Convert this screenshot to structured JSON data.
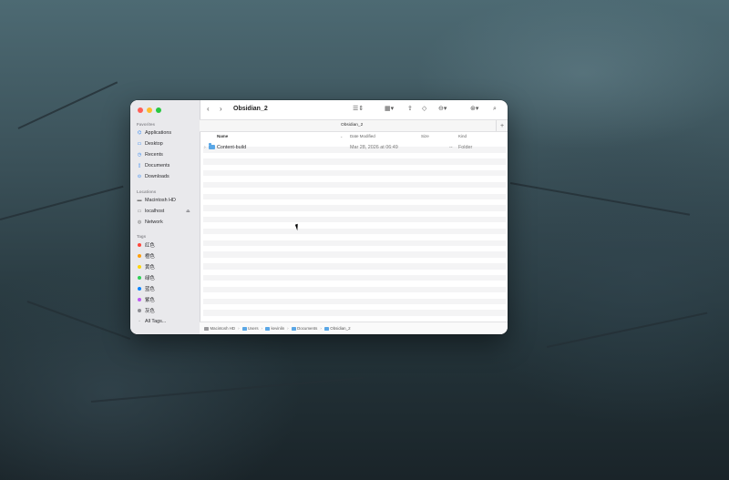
{
  "window": {
    "title": "Obsidian_2"
  },
  "sidebar": {
    "favorites_header": "Favorites",
    "favorites": [
      {
        "label": "Applications",
        "icon": "applications-icon"
      },
      {
        "label": "Desktop",
        "icon": "desktop-icon"
      },
      {
        "label": "Recents",
        "icon": "clock-icon"
      },
      {
        "label": "Documents",
        "icon": "document-icon"
      },
      {
        "label": "Downloads",
        "icon": "download-icon"
      }
    ],
    "locations_header": "Locations",
    "locations": [
      {
        "label": "Macintosh HD",
        "icon": "hard-drive-icon"
      },
      {
        "label": "localhost",
        "icon": "display-icon"
      },
      {
        "label": "Network",
        "icon": "globe-icon"
      }
    ],
    "tags_header": "Tags",
    "tags": [
      {
        "label": "红色",
        "color": "#ff453a"
      },
      {
        "label": "橙色",
        "color": "#ff9f0a"
      },
      {
        "label": "黄色",
        "color": "#ffd60a"
      },
      {
        "label": "绿色",
        "color": "#30d158"
      },
      {
        "label": "蓝色",
        "color": "#0a84ff"
      },
      {
        "label": "紫色",
        "color": "#bf5af2"
      },
      {
        "label": "灰色",
        "color": "#8e8e93"
      }
    ],
    "all_tags": "All Tags..."
  },
  "tab": {
    "title": "Obsidian_2"
  },
  "columns": {
    "name": "Name",
    "date": "Date Modified",
    "size": "Size",
    "kind": "Kind"
  },
  "files": [
    {
      "name": "Content-build",
      "date": "Mar 28, 2026 at 06:49",
      "size": "--",
      "kind": "Folder"
    }
  ],
  "path": [
    {
      "label": "Macintosh HD",
      "icon": "hard-drive-icon"
    },
    {
      "label": "Users",
      "icon": "folder-icon"
    },
    {
      "label": "kevinlin",
      "icon": "folder-icon"
    },
    {
      "label": "Documents",
      "icon": "folder-icon"
    },
    {
      "label": "Obsidian_2",
      "icon": "folder-icon"
    }
  ]
}
